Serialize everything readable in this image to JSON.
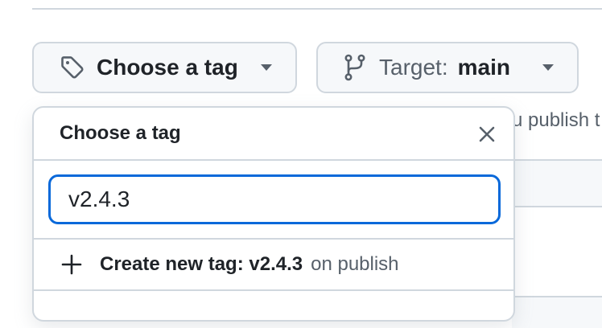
{
  "tag_button": {
    "label": "Choose a tag",
    "icon": "tag-icon",
    "caret": "caret-down-icon"
  },
  "target_button": {
    "prefix": "Target:",
    "value": "main",
    "icon": "git-branch-icon",
    "caret": "caret-down-icon"
  },
  "background": {
    "hint_text": "u publish t"
  },
  "dropdown": {
    "title": "Choose a tag",
    "close_icon": "close-icon",
    "filter": {
      "value": "v2.4.3",
      "placeholder": ""
    },
    "create": {
      "icon": "plus-icon",
      "label": "Create new tag: v2.4.3",
      "suffix": "on publish"
    }
  },
  "colors": {
    "accent": "#0969da",
    "border": "#d0d7de",
    "button_bg": "#f6f8fa",
    "text": "#1f2328",
    "muted": "#57606a"
  }
}
